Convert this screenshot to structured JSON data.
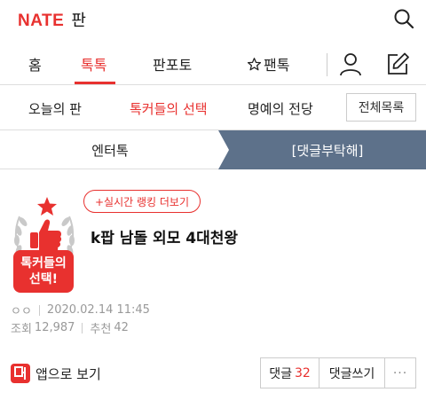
{
  "header": {
    "logo_brand": "NATE",
    "logo_service": "판"
  },
  "nav": {
    "items": [
      {
        "label": "홈",
        "active": false
      },
      {
        "label": "톡톡",
        "active": true
      },
      {
        "label": "판포토",
        "active": false
      },
      {
        "label": "팬톡",
        "active": false,
        "icon": "star-outline-icon"
      }
    ],
    "user_icon": "user-icon",
    "write_icon": "write-icon"
  },
  "subnav": {
    "items": [
      {
        "label": "오늘의 판",
        "active": false
      },
      {
        "label": "톡커들의 선택",
        "active": true
      },
      {
        "label": "명예의 전당",
        "active": false
      }
    ],
    "all_list": "전체목록"
  },
  "tabs": {
    "left": "엔터톡",
    "right": "[댓글부탁해]"
  },
  "article": {
    "badge_line1": "톡커들의",
    "badge_line2": "선택!",
    "live_rank": "+실시간 랭킹 더보기",
    "title": "k팝 남돌 외모 4대천왕",
    "author": "ㅇㅇ",
    "date": "2020.02.14 11:45",
    "views_label": "조회",
    "views": "12,987",
    "recommend_label": "추천",
    "recommend": "42"
  },
  "actions": {
    "app_view": "앱으로 보기",
    "comments_label": "댓글",
    "comments_count": "32",
    "write_comment": "댓글쓰기",
    "more": "···"
  },
  "colors": {
    "accent": "#e8312f",
    "tab_active_bg": "#5d718a"
  }
}
